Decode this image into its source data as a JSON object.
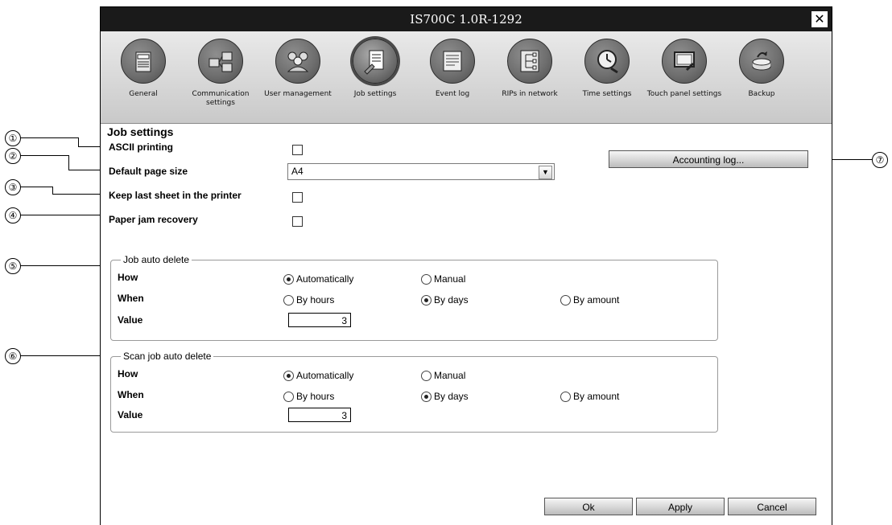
{
  "window": {
    "title": "IS700C 1.0R-1292",
    "close_icon": "close-icon"
  },
  "toolbar": {
    "items": [
      {
        "label": "General",
        "icon": "rip-printer-icon"
      },
      {
        "label": "Communication settings",
        "icon": "network-computers-icon"
      },
      {
        "label": "User management",
        "icon": "users-icon"
      },
      {
        "label": "Job settings",
        "icon": "document-wrench-icon",
        "active": true
      },
      {
        "label": "Event log",
        "icon": "event-log-icon"
      },
      {
        "label": "RIPs in network",
        "icon": "network-tree-icon"
      },
      {
        "label": "Time settings",
        "icon": "clock-icon"
      },
      {
        "label": "Touch panel settings",
        "icon": "touch-panel-icon"
      },
      {
        "label": "Backup",
        "icon": "backup-icon"
      }
    ]
  },
  "page": {
    "title": "Job settings"
  },
  "form": {
    "ascii_printing": {
      "label": "ASCII printing",
      "checked": false
    },
    "default_page_size": {
      "label": "Default page size",
      "value": "A4"
    },
    "keep_last_sheet": {
      "label": "Keep last sheet in the printer",
      "checked": false
    },
    "paper_jam_recovery": {
      "label": "Paper jam recovery",
      "checked": false
    },
    "accounting_log_button": "Accounting log..."
  },
  "job_auto_delete": {
    "legend": "Job auto delete",
    "how_label": "How",
    "how_options": [
      "Automatically",
      "Manual"
    ],
    "how_selected": "Automatically",
    "when_label": "When",
    "when_options": [
      "By hours",
      "By days",
      "By amount"
    ],
    "when_selected": "By days",
    "value_label": "Value",
    "value": "3"
  },
  "scan_job_auto_delete": {
    "legend": "Scan job auto delete",
    "how_label": "How",
    "how_options": [
      "Automatically",
      "Manual"
    ],
    "how_selected": "Automatically",
    "when_label": "When",
    "when_options": [
      "By hours",
      "By days",
      "By amount"
    ],
    "when_selected": "By days",
    "value_label": "Value",
    "value": "3"
  },
  "buttons": {
    "ok": "Ok",
    "apply": "Apply",
    "cancel": "Cancel"
  },
  "callouts": [
    "①",
    "②",
    "③",
    "④",
    "⑤",
    "⑥",
    "⑦"
  ]
}
